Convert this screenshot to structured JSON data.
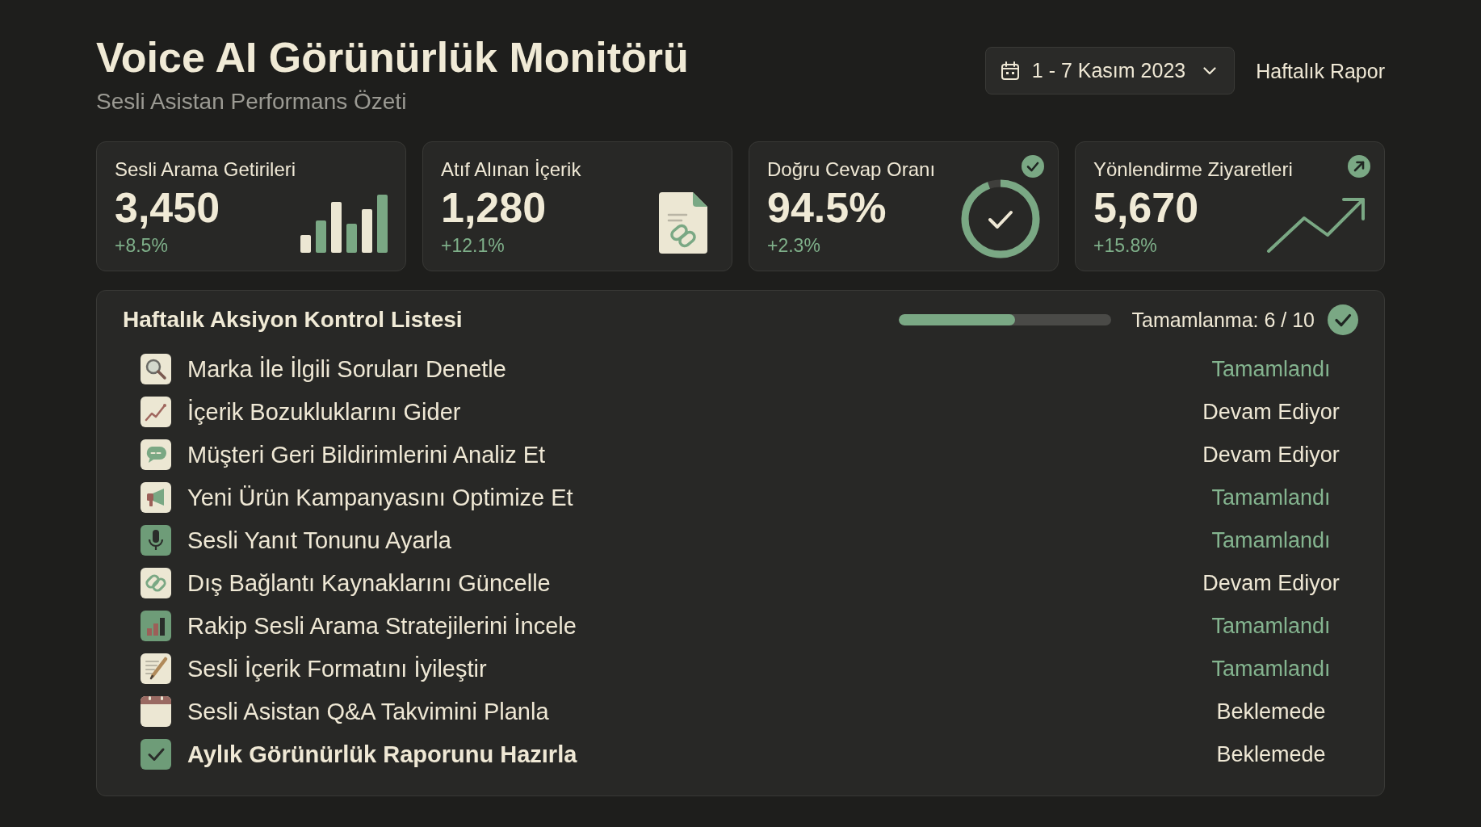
{
  "header": {
    "title": "Voice AI Görünürlük Monitörü",
    "subtitle": "Sesli Asistan Performans Özeti",
    "date_range": "1 - 7 Kasım 2023",
    "report_type": "Haftalık Rapor"
  },
  "metrics": [
    {
      "kind": "bars",
      "label": "Sesli Arama Getirileri",
      "value": "3,450",
      "change": "+8.5%"
    },
    {
      "kind": "document",
      "label": "Atıf Alınan İçerik",
      "value": "1,280",
      "change": "+12.1%"
    },
    {
      "kind": "ring",
      "label": "Doğru Cevap Oranı",
      "value": "94.5%",
      "change": "+2.3%",
      "level": 0.945
    },
    {
      "kind": "trend",
      "label": "Yönlendirme Ziyaretleri",
      "value": "5,670",
      "change": "+15.8%"
    }
  ],
  "checklist": {
    "title": "Haftalık Aksiyon Kontrol Listesi",
    "progress": {
      "level": 0.55,
      "label": "Tamamlanma: 6 / 10"
    },
    "tasks": [
      {
        "kind": "search",
        "label": "Marka İle İlgili Soruları Denetle",
        "status": "Tamamlandı",
        "completed": true,
        "emphasized": false
      },
      {
        "kind": "trend",
        "label": "İçerik Bozukluklarını Gider",
        "status": "Devam Ediyor",
        "completed": false,
        "emphasized": false
      },
      {
        "kind": "chat",
        "label": "Müşteri Geri Bildirimlerini Analiz Et",
        "status": "Devam Ediyor",
        "completed": false,
        "emphasized": false
      },
      {
        "kind": "megaphone",
        "label": "Yeni Ürün Kampanyasını Optimize Et",
        "status": "Tamamlandı",
        "completed": true,
        "emphasized": false
      },
      {
        "kind": "microphone",
        "label": "Sesli Yanıt Tonunu Ayarla",
        "status": "Tamamlandı",
        "completed": true,
        "emphasized": false
      },
      {
        "kind": "link",
        "label": "Dış Bağlantı Kaynaklarını Güncelle",
        "status": "Devam Ediyor",
        "completed": false,
        "emphasized": false
      },
      {
        "kind": "bars",
        "label": "Rakip Sesli Arama Stratejilerini İncele",
        "status": "Tamamlandı",
        "completed": true,
        "emphasized": false
      },
      {
        "kind": "note",
        "label": "Sesli İçerik Formatını İyileştir",
        "status": "Tamamlandı",
        "completed": true,
        "emphasized": false
      },
      {
        "kind": "calendar",
        "label": "Sesli Asistan Q&A Takvimini Planla",
        "status": "Beklemede",
        "completed": false,
        "emphasized": false
      },
      {
        "kind": "tick",
        "label": "Aylık Görünürlük Raporunu Hazırla",
        "status": "Beklemede",
        "completed": false,
        "emphasized": true
      }
    ]
  }
}
